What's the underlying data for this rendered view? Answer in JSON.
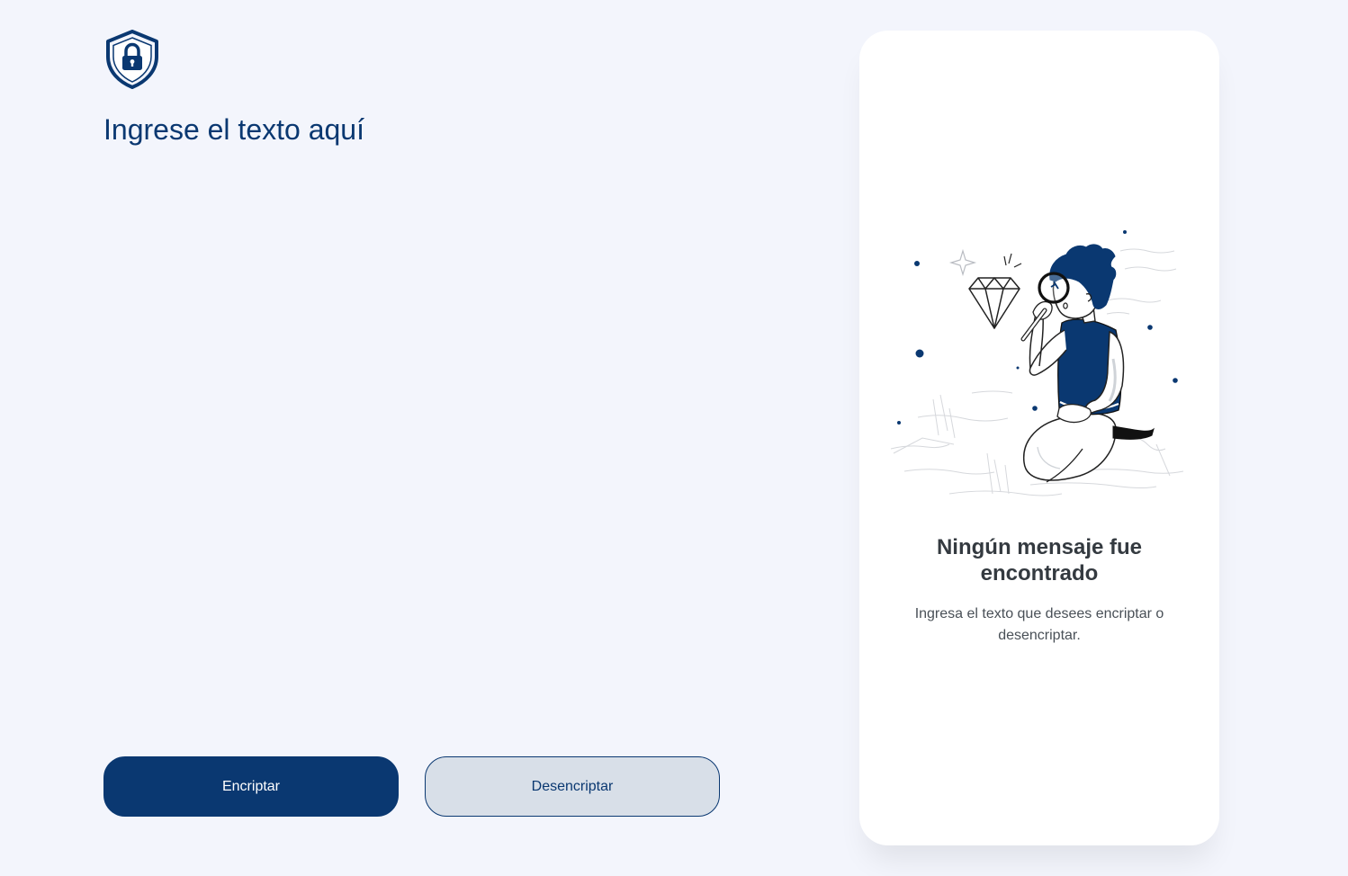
{
  "input": {
    "placeholder": "Ingrese el texto aquí",
    "value": ""
  },
  "buttons": {
    "encrypt_label": "Encriptar",
    "decrypt_label": "Desencriptar"
  },
  "output_panel": {
    "title": "Ningún mensaje fue encontrado",
    "description": "Ingresa el texto que desees encriptar o desencriptar."
  },
  "icons": {
    "logo": "shield-lock-icon",
    "illustration": "person-magnifying-glass-diamond-illustration"
  },
  "colors": {
    "primary": "#0a3871",
    "background": "#f3f5fc",
    "panel": "#ffffff",
    "secondary_button": "#d8dfe8",
    "title_text": "#343a40",
    "body_text": "#495057"
  }
}
